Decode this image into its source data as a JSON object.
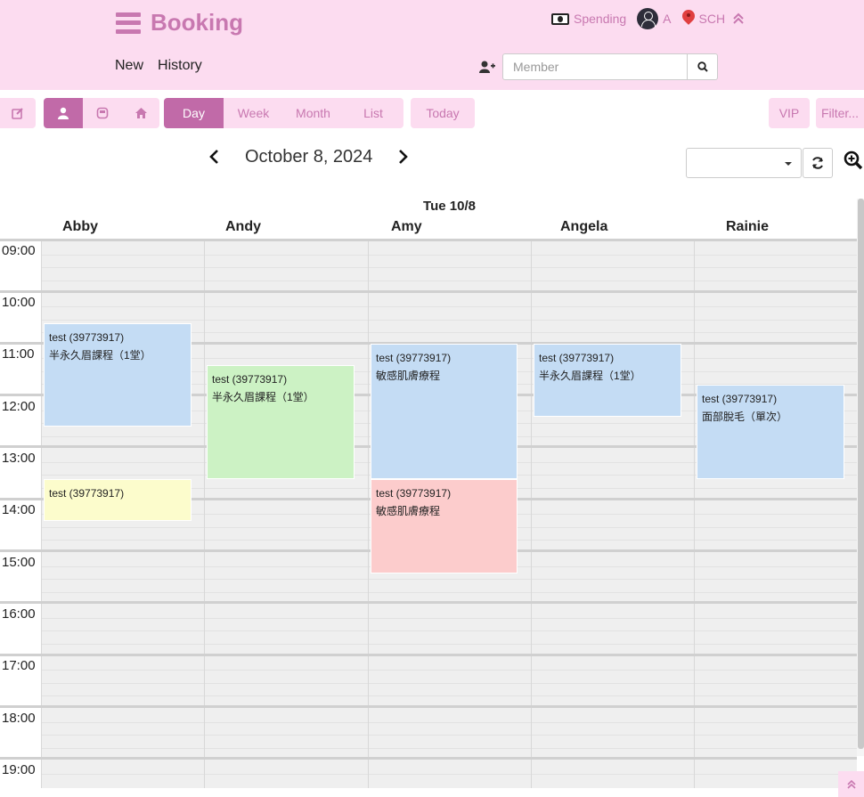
{
  "header": {
    "title": "Booking",
    "spending_label": "Spending",
    "user_label": "A",
    "location_label": "SCH",
    "nav": [
      "New",
      "History"
    ],
    "member_placeholder": "Member"
  },
  "toolbar": {
    "views": [
      "Day",
      "Week",
      "Month",
      "List"
    ],
    "today": "Today",
    "vip": "VIP",
    "filter": "Filter..."
  },
  "date_nav": {
    "title": "October 8, 2024"
  },
  "calendar": {
    "day_header": "Tue 10/8",
    "staff": [
      "Abby",
      "Andy",
      "Amy",
      "Angela",
      "Rainie"
    ],
    "hours": [
      "09:00",
      "10:00",
      "11:00",
      "12:00",
      "13:00",
      "14:00",
      "15:00",
      "16:00",
      "17:00",
      "18:00",
      "19:00"
    ],
    "events": [
      {
        "line1": "test (39773917)",
        "line2": "半永久眉課程（1堂）"
      },
      {
        "line1": "test (39773917)",
        "line2": ""
      },
      {
        "line1": "test (39773917)",
        "line2": "半永久眉課程（1堂）"
      },
      {
        "line1": "test (39773917)",
        "line2": "敏感肌膚療程"
      },
      {
        "line1": "test (39773917)",
        "line2": "敏感肌膚療程"
      },
      {
        "line1": "test (39773917)",
        "line2": "半永久眉課程（1堂）"
      },
      {
        "line1": "test (39773917)",
        "line2": "面部脫毛（單次）"
      }
    ]
  },
  "colors": {
    "brand": "#c878b0",
    "header_bg": "#fcdcf0",
    "active_button": "#c16aa8",
    "event_blue": "#c4dcf4",
    "event_green": "#ccf2c4",
    "event_yellow": "#fcfccc",
    "event_red": "#fccccc"
  }
}
